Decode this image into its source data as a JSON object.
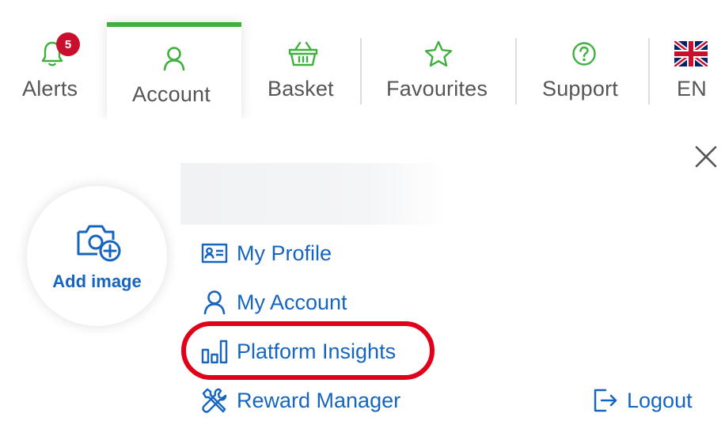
{
  "nav": {
    "alerts": {
      "label": "Alerts",
      "badge": "5"
    },
    "account": {
      "label": "Account"
    },
    "basket": {
      "label": "Basket"
    },
    "favourites": {
      "label": "Favourites"
    },
    "support": {
      "label": "Support"
    },
    "language": {
      "label": "EN",
      "flag": "uk-flag-icon"
    }
  },
  "panel": {
    "add_image": "Add image",
    "menu": [
      {
        "label": "My Profile",
        "icon": "profile-card-icon"
      },
      {
        "label": "My Account",
        "icon": "user-icon"
      },
      {
        "label": "Platform Insights",
        "icon": "bar-chart-icon"
      },
      {
        "label": "Reward Manager",
        "icon": "tools-icon"
      }
    ],
    "logout": "Logout"
  },
  "colors": {
    "accent_green": "#3db03d",
    "link_blue": "#1565c0",
    "badge_red": "#c8102e",
    "highlight_red": "#e0001a"
  }
}
